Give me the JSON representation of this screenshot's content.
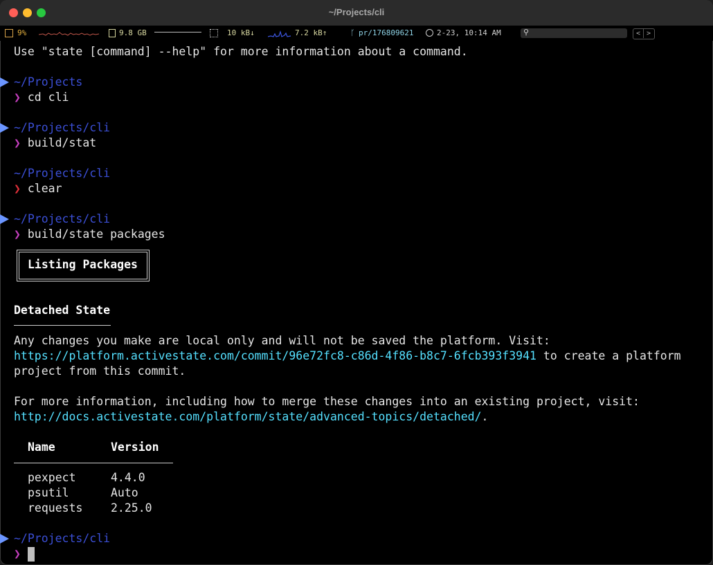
{
  "window": {
    "title": "~/Projects/cli"
  },
  "statusbar": {
    "cpu": "9%",
    "memory": "9.8 GB",
    "net_down": "10 kB↓",
    "net_up": "7.2 kB↑",
    "branch": "pr/176809621",
    "time": "2-23, 10:14 AM",
    "search_value": "",
    "nav_prev": "<",
    "nav_next": ">"
  },
  "terminal": {
    "help_line": "Use \"state [command] --help\" for more information about a command.",
    "blocks": [
      {
        "path": "~/Projects",
        "command": "cd cli"
      },
      {
        "path": "~/Projects/cli",
        "command": "build/stat"
      },
      {
        "path": "~/Projects/cli",
        "command": "clear"
      },
      {
        "path": "~/Projects/cli",
        "command": "build/state packages"
      }
    ],
    "prompt_char": "❯",
    "box_title": "Listing Packages",
    "section_heading": "Detached State",
    "detached_line1": "Any changes you make are local only and will not be saved the platform. Visit:",
    "commit_link": "https://platform.activestate.com/commit/96e72fc8-c86d-4f86-b8c7-6fcb393f3941",
    "detached_line2_suffix": " to create a platform",
    "detached_line3": "project from this commit.",
    "more_info_line": "For more information, including how to merge these changes into an existing project, visit:",
    "docs_link": "http://docs.activestate.com/platform/state/advanced-topics/detached/",
    "docs_suffix": ".",
    "table": {
      "headers": [
        "Name",
        "Version"
      ],
      "rows": [
        [
          "pexpect",
          "4.4.0"
        ],
        [
          "psutil",
          "Auto"
        ],
        [
          "requests",
          "2.25.0"
        ]
      ]
    },
    "final_path": "~/Projects/cli"
  },
  "colors": {
    "path": "#3b4fd6",
    "prompt": "#c63fbf",
    "prompt_error": "#e0303a",
    "link": "#55e0ff",
    "marker": "#6b95ff"
  }
}
